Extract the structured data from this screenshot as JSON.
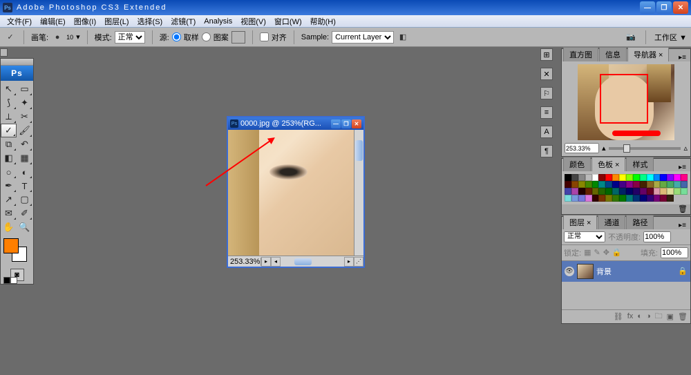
{
  "title": "Adobe Photoshop CS3 Extended",
  "menu": [
    "文件(F)",
    "编辑(E)",
    "图像(I)",
    "图层(L)",
    "选择(S)",
    "滤镜(T)",
    "Analysis",
    "视图(V)",
    "窗口(W)",
    "帮助(H)"
  ],
  "opt": {
    "brush_label": "画笔:",
    "brush_size": "10",
    "mode_label": "模式:",
    "mode_value": "正常",
    "source_label": "源:",
    "source_opt1": "取样",
    "source_opt2": "图案",
    "align_label": "对齐",
    "sample_label": "Sample:",
    "sample_value": "Current Layer",
    "workspace_label": "工作区 ▼"
  },
  "document": {
    "title": "0000.jpg @ 253%(RG...",
    "zoom": "253.33%"
  },
  "nav": {
    "tabs": [
      "直方图",
      "信息",
      "导航器 ×"
    ],
    "zoom": "253.33%"
  },
  "color": {
    "tabs": [
      "颜色",
      "色板 ×",
      "样式"
    ]
  },
  "layers": {
    "tabs": [
      "图层 ×",
      "通道",
      "路径"
    ],
    "blend": "正常",
    "opacity_label": "不透明度:",
    "opacity": "100%",
    "lock_label": "锁定:",
    "fill_label": "填充:",
    "fill": "100%",
    "layer_name": "背景"
  },
  "swatch_colors": [
    "#000",
    "#444",
    "#888",
    "#bbb",
    "#fff",
    "#800",
    "#f00",
    "#f80",
    "#ff0",
    "#8f0",
    "#0f0",
    "#0f8",
    "#0ff",
    "#08f",
    "#00f",
    "#80f",
    "#f0f",
    "#f08",
    "#400",
    "#840",
    "#880",
    "#480",
    "#080",
    "#088",
    "#048",
    "#008",
    "#408",
    "#808",
    "#804",
    "#420",
    "#862",
    "#aa4",
    "#6a4",
    "#4a6",
    "#4aa",
    "#46a",
    "#44a",
    "#a4a",
    "#200",
    "#620",
    "#660",
    "#260",
    "#060",
    "#066",
    "#026",
    "#006",
    "#206",
    "#606",
    "#602",
    "#d9a",
    "#db7",
    "#dd9",
    "#9d7",
    "#7d9",
    "#7dd",
    "#79d",
    "#77d",
    "#d7d",
    "#300",
    "#730",
    "#770",
    "#370",
    "#070",
    "#077",
    "#037",
    "#007",
    "#307",
    "#707",
    "#703",
    "#321"
  ]
}
